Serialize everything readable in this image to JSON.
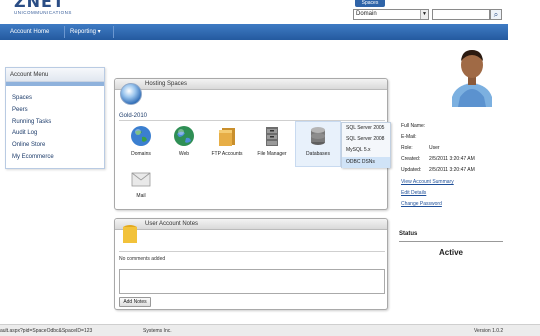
{
  "header": {
    "logo_text": "ZNET",
    "logo_tagline": "UNICOMMUNICATIONS",
    "spaces_tab": "Spaces",
    "domain_select": "Domain",
    "search_placeholder": ""
  },
  "nav": {
    "items": [
      {
        "label": "Account Home"
      },
      {
        "label": "Reporting ▾"
      }
    ]
  },
  "sidebar": {
    "title": "Account Menu",
    "items": [
      {
        "label": "Spaces"
      },
      {
        "label": "Peers"
      },
      {
        "label": "Running Tasks"
      },
      {
        "label": "Audit Log"
      },
      {
        "label": "Online Store"
      },
      {
        "label": "My Ecommerce"
      }
    ]
  },
  "hosting": {
    "title": "Hosting Spaces",
    "space_name": "Gold-2010",
    "tiles": [
      {
        "label": "Domains",
        "icon": "globe-icon"
      },
      {
        "label": "Web",
        "icon": "web-globe-icon"
      },
      {
        "label": "FTP Accounts",
        "icon": "ftp-folder-icon"
      },
      {
        "label": "File Manager",
        "icon": "file-manager-icon"
      },
      {
        "label": "Databases",
        "icon": "database-icon"
      },
      {
        "label": "Mail",
        "icon": "mail-icon"
      }
    ],
    "db_menu": [
      {
        "label": "SQL Server 2005"
      },
      {
        "label": "SQL Server 2008"
      },
      {
        "label": "MySQL 5.x"
      },
      {
        "label": "ODBC DSNs"
      }
    ]
  },
  "notes": {
    "title": "User Account Notes",
    "empty_text": "No comments added",
    "button": "Add Notes"
  },
  "user": {
    "name": "",
    "full_name_label": "Full Name:",
    "email_label": "E-Mail:",
    "role_label": "Role:",
    "role_value": "User",
    "created_label": "Created:",
    "created_value": "2/5/2011 3:20:47 AM",
    "updated_label": "Updated:",
    "updated_value": "2/5/2011 3:20:47 AM",
    "links": [
      {
        "label": "View Account Summary"
      },
      {
        "label": "Edit Details"
      },
      {
        "label": "Change Password"
      }
    ]
  },
  "status": {
    "title": "Status",
    "value": "Active"
  },
  "footer": {
    "url": "ault.aspx?pid=SpaceOdbc&SpaceID=123",
    "company": "Systems Inc.",
    "version": "Version 1.0.2"
  },
  "colors": {
    "nav": "#2f64a8",
    "link": "#1e4f99"
  }
}
